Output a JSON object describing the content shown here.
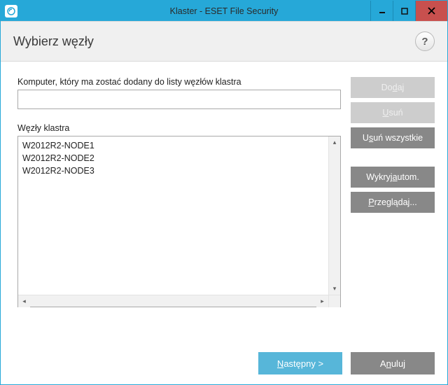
{
  "window": {
    "title": "Klaster - ESET File Security"
  },
  "header": {
    "title": "Wybierz węzły",
    "help": "?"
  },
  "fields": {
    "computer_label": "Komputer, który ma zostać dodany do listy węzłów klastra",
    "computer_value": "",
    "nodes_label": "Węzły klastra"
  },
  "nodes": [
    "W2012R2-NODE1",
    "W2012R2-NODE2",
    "W2012R2-NODE3"
  ],
  "buttons": {
    "add_pre": "Do",
    "add_ul": "d",
    "add_post": "aj",
    "remove_ul": "U",
    "remove_post": "suń",
    "remove_all_pre": "U",
    "remove_all_ul": "s",
    "remove_all_post": "uń wszystkie",
    "detect_pre": "Wykryj ",
    "detect_ul": "a",
    "detect_post": "utom.",
    "browse_ul": "P",
    "browse_post": "rzeglądaj...",
    "next_ul": "N",
    "next_post": "astępny >",
    "cancel_pre": "A",
    "cancel_ul": "n",
    "cancel_post": "uluj"
  },
  "win_controls": {
    "minimize": "▁",
    "maximize": "▢",
    "close": "✕"
  }
}
